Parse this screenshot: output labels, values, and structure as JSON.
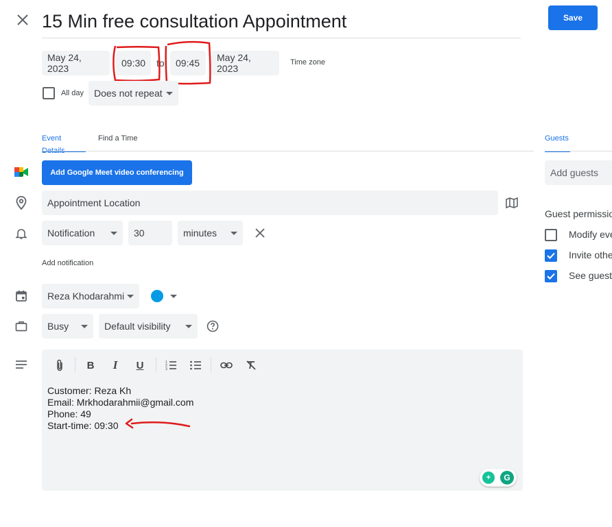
{
  "header": {
    "title": "15 Min free consultation Appointment",
    "save_label": "Save"
  },
  "datetime": {
    "start_date": "May 24, 2023",
    "start_time": "09:30",
    "separator": "to",
    "end_time": "09:45",
    "end_date": "May 24, 2023",
    "timezone_label": "Time zone",
    "all_day_label": "All day",
    "repeat_value": "Does not repeat"
  },
  "tabs": {
    "event_details": "Event Details",
    "find_time": "Find a Time",
    "guests": "Guests"
  },
  "details": {
    "meet_button": "Add Google Meet video conferencing",
    "location_value": "Appointment Location",
    "notification_type": "Notification",
    "notification_amount": "30",
    "notification_unit": "minutes",
    "add_notification": "Add notification",
    "calendar_owner": "Reza Khodarahmi",
    "calendar_color": "#039be5",
    "availability": "Busy",
    "visibility": "Default visibility"
  },
  "description": {
    "line1": "Customer: Reza Kh",
    "line2": "Email: Mrkhodarahmii@gmail.com",
    "line3": "Phone: 49",
    "line4": "Start-time: 09:30"
  },
  "guests": {
    "add_placeholder": "Add guests",
    "permissions_label": "Guest permissio",
    "perm_modify": "Modify eve",
    "perm_invite": "Invite othe",
    "perm_see": "See guest"
  },
  "colors": {
    "accent": "#1a73e8",
    "annotation": "#e01b1b"
  }
}
